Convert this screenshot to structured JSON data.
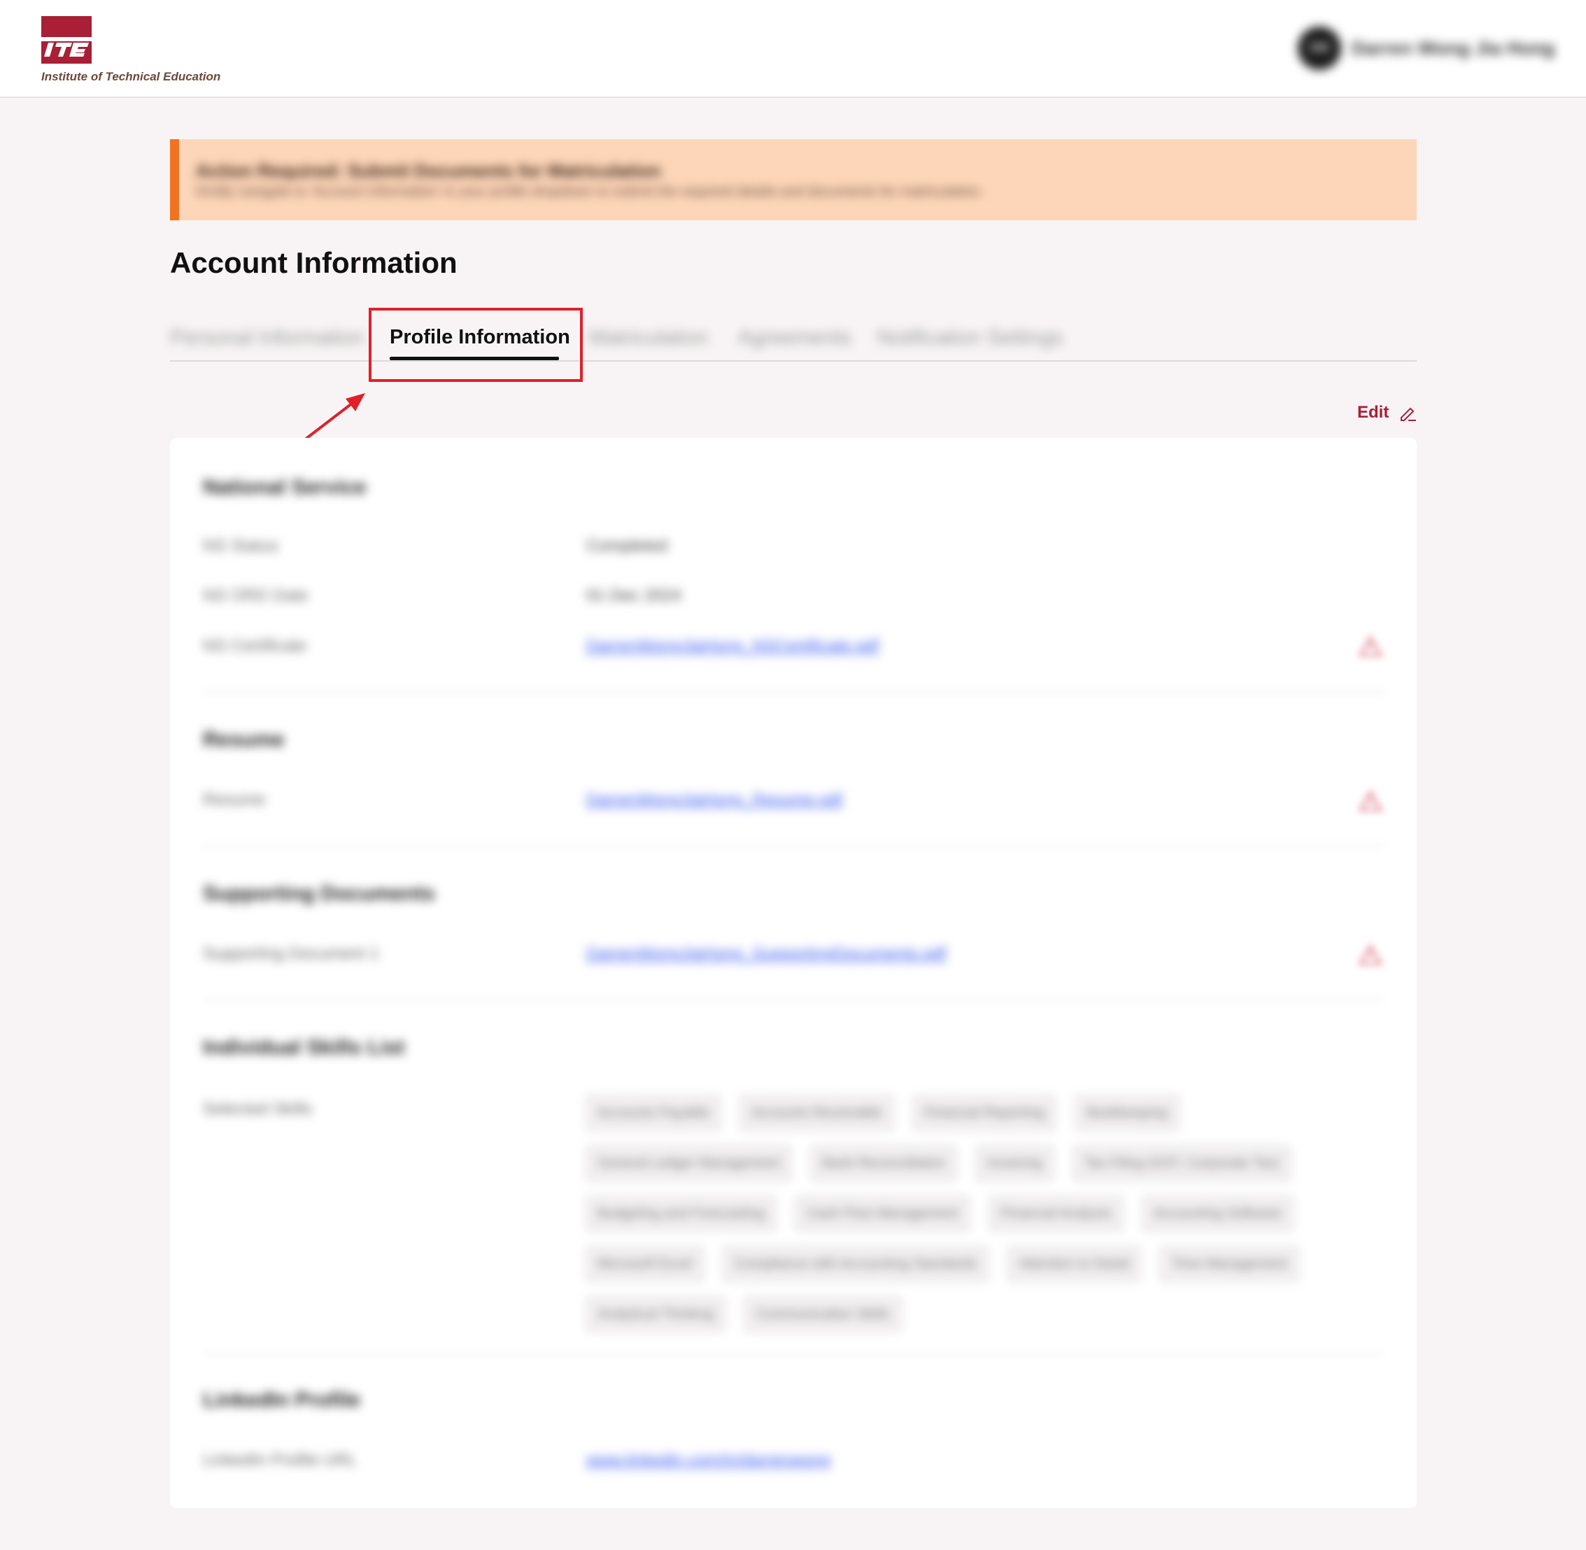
{
  "header": {
    "logo_mark": "ITE",
    "logo_text": "Institute of Technical Education",
    "user_initials": "DW",
    "user_name": "Darren Wong Jia Hong"
  },
  "banner": {
    "title": "Action Required: Submit Documents for Matriculation",
    "text": "Kindly navigate to 'Account Information' in your profile dropdown to submit the required details and documents for matriculation."
  },
  "page_title": "Account Information",
  "tabs": [
    {
      "label": "Personal Information"
    },
    {
      "label": "Profile Information"
    },
    {
      "label": "Matriculation"
    },
    {
      "label": "Agreements"
    },
    {
      "label": "Notification Settings"
    }
  ],
  "edit_label": "Edit",
  "sections": {
    "national_service": {
      "title": "National Service",
      "rows": [
        {
          "label": "NS Status",
          "value": "Completed"
        },
        {
          "label": "NS ORD Date",
          "value": "01 Dec 2024"
        },
        {
          "label": "NS Certificate",
          "value": "DarrenWongJiaHong_NSCertificate.pdf"
        }
      ]
    },
    "resume": {
      "title": "Resume",
      "rows": [
        {
          "label": "Resume",
          "value": "DarrenWongJiaHong_Resume.pdf"
        }
      ]
    },
    "supporting_documents": {
      "title": "Supporting Documents",
      "rows": [
        {
          "label": "Supporting Document 1",
          "value": "DarrenWongJiaHong_SupportingDocuments.pdf"
        }
      ]
    },
    "skills": {
      "title": "Individual Skills List",
      "label": "Selected Skills",
      "chips": [
        "Accounts Payable",
        "Accounts Receivable",
        "Financial Reporting",
        "Bookkeeping",
        "General Ledger Management",
        "Bank Reconciliation",
        "Invoicing",
        "Tax Filing (GST, Corporate Tax)",
        "Budgeting and Forecasting",
        "Cash Flow Management",
        "Financial Analysis",
        "Accounting Software",
        "Microsoft Excel",
        "Compliance with Accounting Standards",
        "Attention to Detail",
        "Time Management",
        "Analytical Thinking",
        "Communication Skills"
      ]
    },
    "linkedin": {
      "title": "LinkedIn Profile",
      "label": "LinkedIn Profile URL",
      "value": "www.linkedin.com/in/darrenwong"
    }
  }
}
